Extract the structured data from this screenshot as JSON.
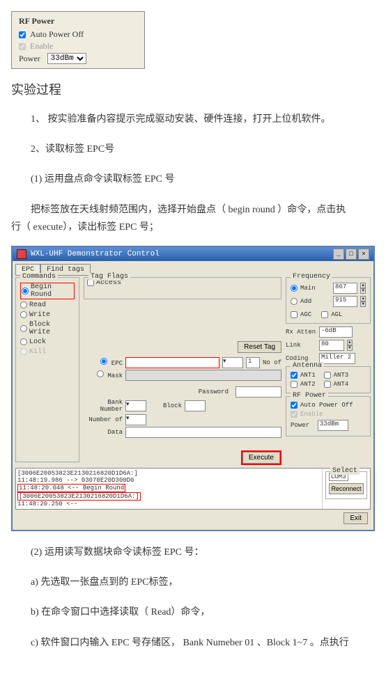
{
  "rfpanel": {
    "title": "RF Power",
    "auto": "Auto Power Off",
    "enable": "Enable",
    "power": "Power",
    "power_val": "33dBm"
  },
  "heading": "实验过程",
  "steps": {
    "s1": "1、 按实验准备内容提示完成驱动安装、硬件连接，打开上位机软件。",
    "s2": "2、读取标签  EPC号",
    "s2a": "(1) 运用盘点命令读取标签   EPC 号",
    "s2b_1": "把标签放在天线射频范围内，选择开始盘点（     begin round  ）命令，点击执",
    "s2b_2": "行（ execute），读出标签  EPC 号；",
    "s3": "(2) 运用读写数据块命令读标签    EPC 号：",
    "s3a": "a)  先选取一张盘点到的   EPC标签，",
    "s3b": "b)  在命令窗口中选择读取（   Read）命令，",
    "s3c": "c)  软件窗口内输入  EPC 号存储区， Bank Numeber 01 、Block 1~7  。点执行"
  },
  "win": {
    "title": "WXL-UHF Demonstrator Control",
    "tabs": {
      "epc": "EPC",
      "find": "Find tags"
    },
    "cmds": {
      "title": "Commands",
      "begin": "Begin Round",
      "read": "Read",
      "write": "Write",
      "blockw": "Block Write",
      "lock": "Lock",
      "kill": "Kill"
    },
    "tagflags": {
      "title": "Tag Flags",
      "access": "Access"
    },
    "reset": "Reset Tag",
    "epc_lbl": "EPC",
    "mask_lbl": "Mask",
    "noof": "No of",
    "one": "1",
    "password": "Password",
    "bankno": "Bank Number",
    "block": "Block",
    "numberof": "Number of",
    "data": "Data",
    "execute": "Execute",
    "freq": {
      "title": "Frequency",
      "main": "Main",
      "main_val": "867",
      "add": "Add",
      "add_val": "915",
      "agc": "AGC",
      "agl": "AGL"
    },
    "rxatten": "Rx Atten",
    "rxatten_val": "-6dB",
    "link": "Link",
    "link_val": "80",
    "coding": "Coding",
    "coding_val": "Miller 2",
    "antenna": {
      "title": "Antenna",
      "a1": "ANT1",
      "a2": "ANT2",
      "a3": "ANT3",
      "a4": "ANT4"
    },
    "rfp": {
      "title": "RF Power",
      "auto": "Auto Power Off",
      "enable": "Enable",
      "power": "Power",
      "power_val": "33dBm"
    },
    "select": {
      "title": "Select",
      "com": "COM3",
      "reconnect": "Reconnect"
    },
    "exit": "Exit",
    "log": {
      "l1": "[3006E20053823E2130216820D1D6A:]",
      "l2": "11:48:19.986   --> 03070E20D300D0",
      "l3": "11:48:20.048   <-- Begin Round",
      "l4": "[3006E20053823E2130216820D1D6A:]",
      "l5": "11:48:20.250   <--"
    }
  }
}
